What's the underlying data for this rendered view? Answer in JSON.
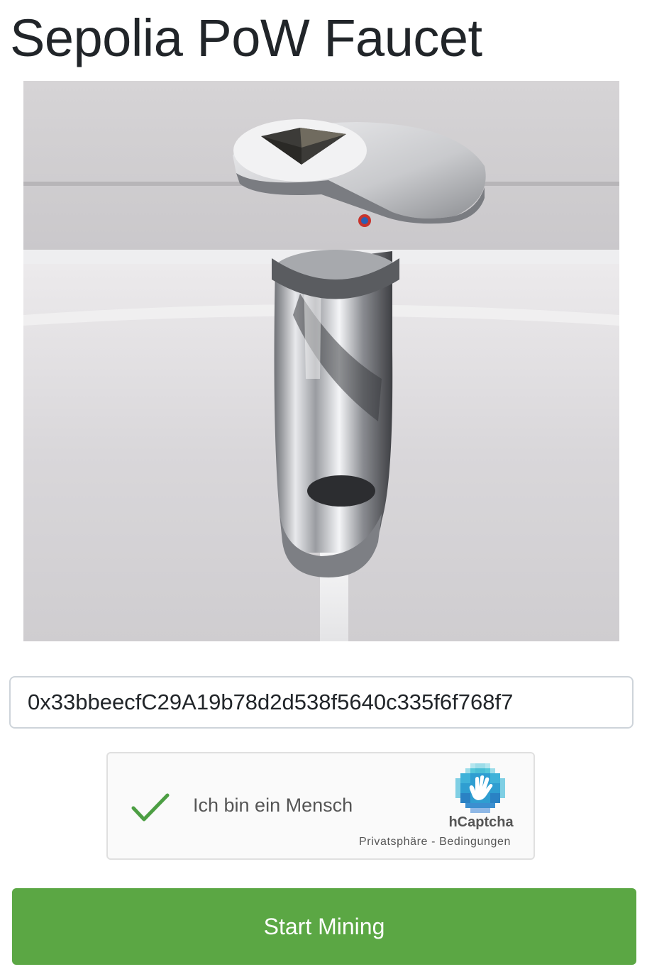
{
  "header": {
    "title": "Sepolia PoW Faucet"
  },
  "hero": {
    "description": "faucet-image"
  },
  "form": {
    "address_value": "0x33bbeecfC29A19b78d2d538f5640c335f6f768f7"
  },
  "captcha": {
    "label": "Ich bin ein Mensch",
    "brand": "hCaptcha",
    "privacy_link": "Privatsphäre",
    "separator": " - ",
    "terms_link": "Bedingungen",
    "checked": true,
    "check_color": "#4c9e43"
  },
  "actions": {
    "start_label": "Start Mining",
    "start_color": "#5ba744"
  }
}
